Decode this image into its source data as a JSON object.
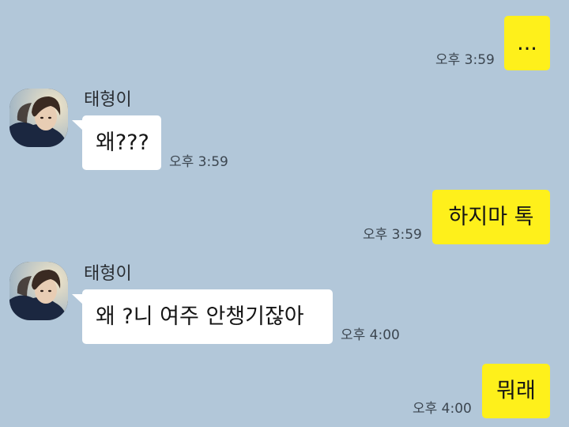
{
  "chat": {
    "contact_name": "태형이",
    "messages": [
      {
        "sender": "me",
        "text": "...",
        "time": "오후 3:59"
      },
      {
        "sender": "contact",
        "text": "왜???",
        "time": "오후 3:59"
      },
      {
        "sender": "me",
        "text": "하지마 톡",
        "time": "오후 3:59"
      },
      {
        "sender": "contact",
        "text": "왜 ?니 여주 안챙기잖아",
        "time": "오후 4:00"
      },
      {
        "sender": "me",
        "text": "뭐래",
        "time": "오후 4:00"
      }
    ]
  },
  "colors": {
    "background": "#b2c7d9",
    "my_bubble": "#fef01b",
    "their_bubble": "#ffffff"
  },
  "icons": {
    "avatar": "profile-photo"
  }
}
